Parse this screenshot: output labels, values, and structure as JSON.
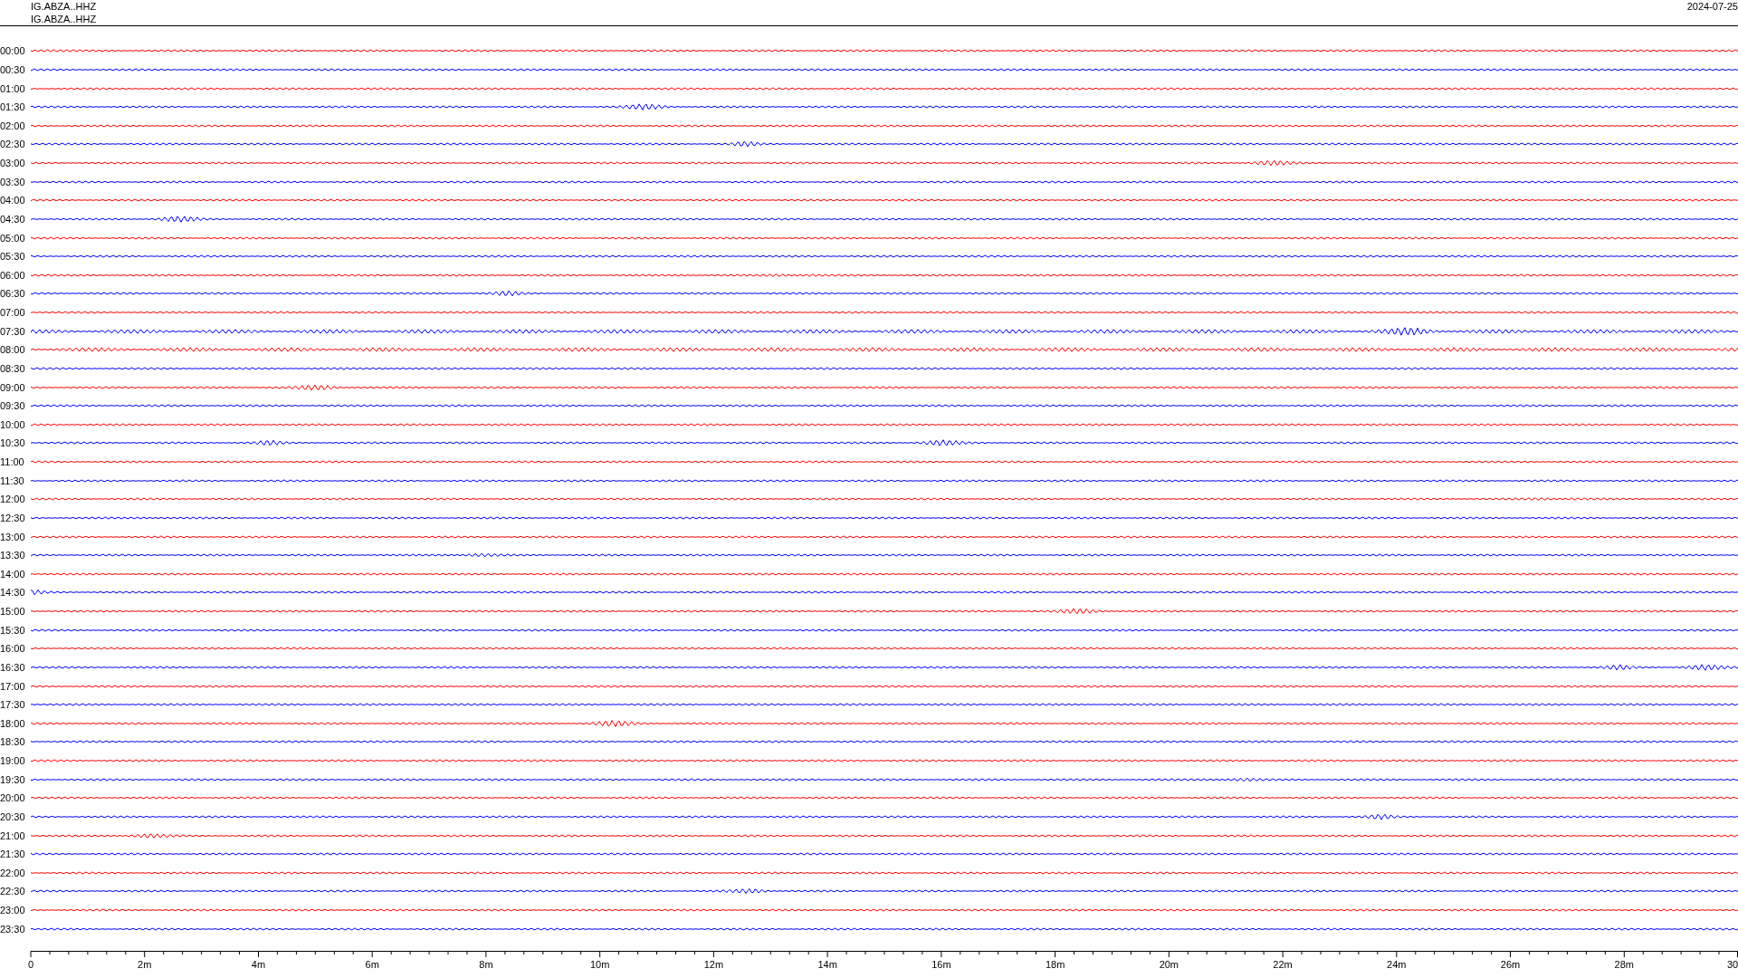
{
  "header": {
    "station_lines": [
      "IG.ABZA..HHZ",
      "IG.ABZA..HHZ"
    ],
    "date": "2024-07-25"
  },
  "traces": [
    {
      "time": "00:00",
      "color": "#ff0000"
    },
    {
      "time": "00:30",
      "color": "#0000ff"
    },
    {
      "time": "01:00",
      "color": "#ff0000"
    },
    {
      "time": "01:30",
      "color": "#0000ff"
    },
    {
      "time": "02:00",
      "color": "#ff0000"
    },
    {
      "time": "02:30",
      "color": "#0000ff"
    },
    {
      "time": "03:00",
      "color": "#ff0000"
    },
    {
      "time": "03:30",
      "color": "#0000ff"
    },
    {
      "time": "04:00",
      "color": "#ff0000"
    },
    {
      "time": "04:30",
      "color": "#0000ff"
    },
    {
      "time": "05:00",
      "color": "#ff0000"
    },
    {
      "time": "05:30",
      "color": "#0000ff"
    },
    {
      "time": "06:00",
      "color": "#ff0000"
    },
    {
      "time": "06:30",
      "color": "#0000ff"
    },
    {
      "time": "07:00",
      "color": "#ff0000"
    },
    {
      "time": "07:30",
      "color": "#0000ff"
    },
    {
      "time": "08:00",
      "color": "#ff0000"
    },
    {
      "time": "08:30",
      "color": "#0000ff"
    },
    {
      "time": "09:00",
      "color": "#ff0000"
    },
    {
      "time": "09:30",
      "color": "#0000ff"
    },
    {
      "time": "10:00",
      "color": "#ff0000"
    },
    {
      "time": "10:30",
      "color": "#0000ff"
    },
    {
      "time": "11:00",
      "color": "#ff0000"
    },
    {
      "time": "11:30",
      "color": "#0000ff"
    },
    {
      "time": "12:00",
      "color": "#ff0000"
    },
    {
      "time": "12:30",
      "color": "#0000ff"
    },
    {
      "time": "13:00",
      "color": "#ff0000"
    },
    {
      "time": "13:30",
      "color": "#0000ff"
    },
    {
      "time": "14:00",
      "color": "#ff0000"
    },
    {
      "time": "14:30",
      "color": "#0000ff"
    },
    {
      "time": "15:00",
      "color": "#ff0000"
    },
    {
      "time": "15:30",
      "color": "#0000ff"
    },
    {
      "time": "16:00",
      "color": "#ff0000"
    },
    {
      "time": "16:30",
      "color": "#0000ff"
    },
    {
      "time": "17:00",
      "color": "#ff0000"
    },
    {
      "time": "17:30",
      "color": "#0000ff"
    },
    {
      "time": "18:00",
      "color": "#ff0000"
    },
    {
      "time": "18:30",
      "color": "#0000ff"
    },
    {
      "time": "19:00",
      "color": "#ff0000"
    },
    {
      "time": "19:30",
      "color": "#0000ff"
    },
    {
      "time": "20:00",
      "color": "#ff0000"
    },
    {
      "time": "20:30",
      "color": "#0000ff"
    },
    {
      "time": "21:00",
      "color": "#ff0000"
    },
    {
      "time": "21:30",
      "color": "#0000ff"
    },
    {
      "time": "22:00",
      "color": "#ff0000"
    },
    {
      "time": "22:30",
      "color": "#0000ff"
    },
    {
      "time": "23:00",
      "color": "#ff0000"
    },
    {
      "time": "23:30",
      "color": "#0000ff"
    }
  ],
  "x_axis": {
    "labels": [
      "0",
      "2m",
      "4m",
      "6m",
      "8m",
      "10m",
      "12m",
      "14m",
      "16m",
      "18m",
      "20m",
      "22m",
      "24m",
      "26m",
      "28m",
      "30"
    ]
  }
}
